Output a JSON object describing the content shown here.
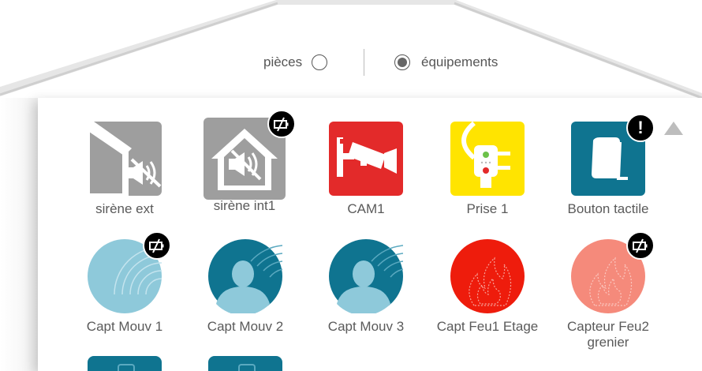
{
  "view_toggle": {
    "rooms_label": "pièces",
    "devices_label": "équipements",
    "selected": "équipements"
  },
  "devices": [
    {
      "label": "sirène ext",
      "icon": "outdoor-siren-icon",
      "color": "#9e9e9e",
      "status_badge": null
    },
    {
      "label": "sirène int1",
      "icon": "indoor-siren-icon",
      "color": "#9e9e9e",
      "status_badge": "battery-off-icon"
    },
    {
      "label": "CAM1",
      "icon": "camera-icon",
      "color": "#e32a2a",
      "status_badge": null
    },
    {
      "label": "Prise 1",
      "icon": "smart-plug-icon",
      "color": "#ffe400",
      "status_badge": null
    },
    {
      "label": "Bouton tactile",
      "icon": "touch-button-icon",
      "color": "#0f7490",
      "status_badge": "alert-icon"
    },
    {
      "label": "Capt Mouv 1",
      "icon": "motion-sensor-icon",
      "color": "#8ec9da",
      "status_badge": "battery-off-icon"
    },
    {
      "label": "Capt Mouv 2",
      "icon": "motion-sensor-person-icon",
      "color": "#0f7490",
      "status_badge": null
    },
    {
      "label": "Capt Mouv 3",
      "icon": "motion-sensor-person-icon",
      "color": "#0f7490",
      "status_badge": null
    },
    {
      "label": "Capt Feu1 Etage",
      "icon": "fire-sensor-icon",
      "color": "#ee1c0c",
      "status_badge": null
    },
    {
      "label": "Capteur Feu2 grenier",
      "icon": "fire-sensor-icon",
      "color": "#f58a7b",
      "status_badge": "battery-off-icon"
    }
  ]
}
